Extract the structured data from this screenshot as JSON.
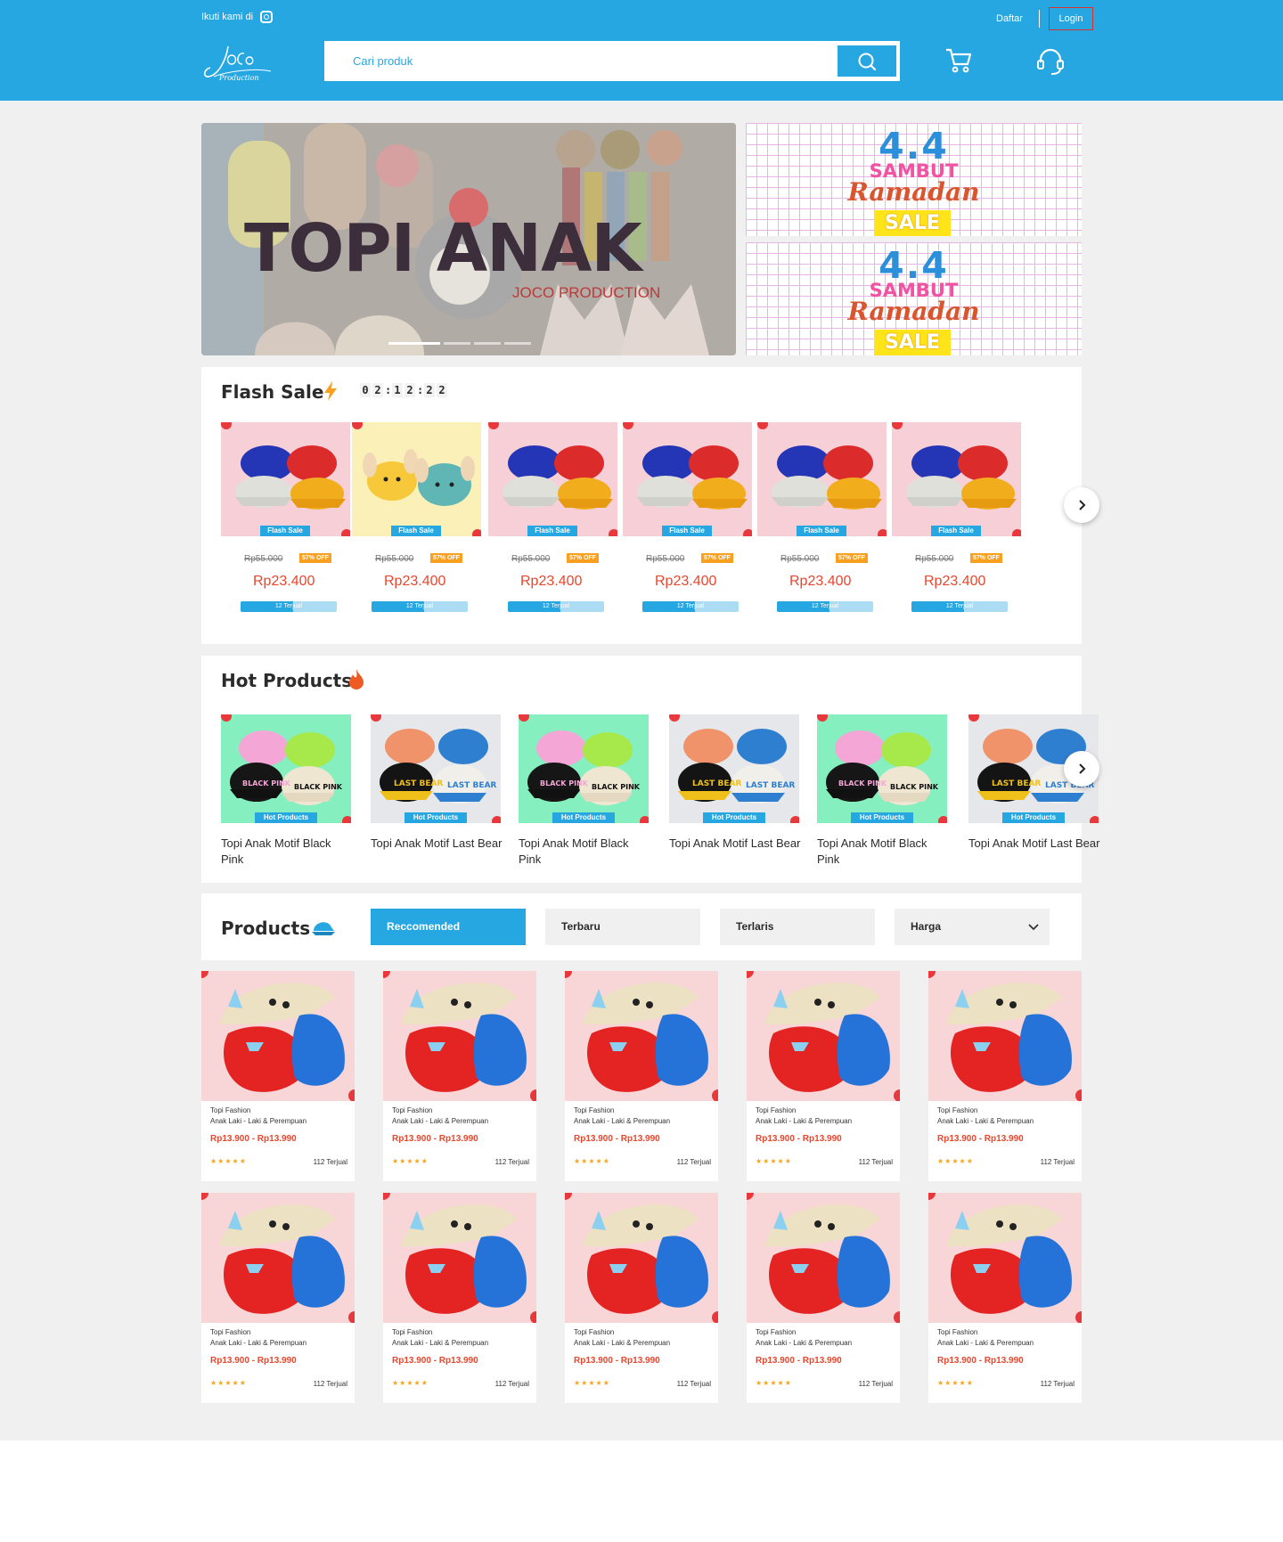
{
  "header": {
    "follow_text": "Ikuti kami di",
    "register_label": "Daftar",
    "login_label": "Login",
    "search_placeholder": "Cari produk",
    "logo_text": "Joco Production"
  },
  "hero": {
    "title": "TOPI ANAK",
    "subtitle": "JOCO PRODUCTION",
    "promo_number": "4.4",
    "promo_line1": "SAMBUT",
    "promo_line2": "Ramadan",
    "promo_line3": "SALE"
  },
  "flash_sale": {
    "title": "Flash Sale",
    "timer": [
      "0",
      "2",
      "1",
      "2",
      "2",
      "2"
    ],
    "items": [
      {
        "badge": "Flash Sale",
        "original_price": "Rp55.000",
        "discount": "57% OFF",
        "price": "Rp23.400",
        "sold": "12 Terjual",
        "sold_fraction": 0.55,
        "variant": "caps"
      },
      {
        "badge": "Flash Sale",
        "original_price": "Rp55.000",
        "discount": "57% OFF",
        "price": "Rp23.400",
        "sold": "12 Terjual",
        "sold_fraction": 0.55,
        "variant": "bunny"
      },
      {
        "badge": "Flash Sale",
        "original_price": "Rp55.000",
        "discount": "57% OFF",
        "price": "Rp23.400",
        "sold": "12 Terjual",
        "sold_fraction": 0.55,
        "variant": "caps"
      },
      {
        "badge": "Flash Sale",
        "original_price": "Rp55.000",
        "discount": "57% OFF",
        "price": "Rp23.400",
        "sold": "12 Terjual",
        "sold_fraction": 0.55,
        "variant": "caps"
      },
      {
        "badge": "Flash Sale",
        "original_price": "Rp55.000",
        "discount": "57% OFF",
        "price": "Rp23.400",
        "sold": "12 Terjual",
        "sold_fraction": 0.55,
        "variant": "caps"
      },
      {
        "badge": "Flash Sale",
        "original_price": "Rp55.000",
        "discount": "57% OFF",
        "price": "Rp23.400",
        "sold": "12 Terjual",
        "sold_fraction": 0.55,
        "variant": "caps"
      }
    ]
  },
  "hot_products": {
    "title": "Hot Products",
    "items": [
      {
        "badge": "Hot Products",
        "name": "Topi Anak Motif Black Pink",
        "variant": "blackpink"
      },
      {
        "badge": "Hot Products",
        "name": "Topi Anak Motif Last Bear",
        "variant": "lastbear"
      },
      {
        "badge": "Hot Products",
        "name": "Topi Anak Motif Black Pink",
        "variant": "blackpink"
      },
      {
        "badge": "Hot Products",
        "name": "Topi Anak Motif Last Bear",
        "variant": "lastbear"
      },
      {
        "badge": "Hot Products",
        "name": "Topi Anak Motif Black Pink",
        "variant": "blackpink"
      },
      {
        "badge": "Hot Products",
        "name": "Topi Anak Motif Last Bear",
        "variant": "lastbear"
      }
    ]
  },
  "products": {
    "title": "Products",
    "tabs": [
      {
        "label": "Reccomended",
        "active": true
      },
      {
        "label": "Terbaru",
        "active": false
      },
      {
        "label": "Terlaris",
        "active": false
      },
      {
        "label": "Harga",
        "active": false,
        "dropdown": true
      }
    ],
    "items": [
      {
        "category": "Topi Fashion",
        "name": "Anak Laki - Laki & Perempuan",
        "price": "Rp13.900 - Rp13.990",
        "rating": 5,
        "sold": "112 Terjual"
      },
      {
        "category": "Topi Fashion",
        "name": "Anak Laki - Laki & Perempuan",
        "price": "Rp13.900 - Rp13.990",
        "rating": 5,
        "sold": "112 Terjual"
      },
      {
        "category": "Topi Fashion",
        "name": "Anak Laki - Laki & Perempuan",
        "price": "Rp13.900 - Rp13.990",
        "rating": 5,
        "sold": "112 Terjual"
      },
      {
        "category": "Topi Fashion",
        "name": "Anak Laki - Laki & Perempuan",
        "price": "Rp13.900 - Rp13.990",
        "rating": 5,
        "sold": "112 Terjual"
      },
      {
        "category": "Topi Fashion",
        "name": "Anak Laki - Laki & Perempuan",
        "price": "Rp13.900 - Rp13.990",
        "rating": 5,
        "sold": "112 Terjual"
      },
      {
        "category": "Topi Fashion",
        "name": "Anak Laki - Laki & Perempuan",
        "price": "Rp13.900 - Rp13.990",
        "rating": 5,
        "sold": "112 Terjual"
      },
      {
        "category": "Topi Fashion",
        "name": "Anak Laki - Laki & Perempuan",
        "price": "Rp13.900 - Rp13.990",
        "rating": 5,
        "sold": "112 Terjual"
      },
      {
        "category": "Topi Fashion",
        "name": "Anak Laki - Laki & Perempuan",
        "price": "Rp13.900 - Rp13.990",
        "rating": 5,
        "sold": "112 Terjual"
      },
      {
        "category": "Topi Fashion",
        "name": "Anak Laki - Laki & Perempuan",
        "price": "Rp13.900 - Rp13.990",
        "rating": 5,
        "sold": "112 Terjual"
      },
      {
        "category": "Topi Fashion",
        "name": "Anak Laki - Laki & Perempuan",
        "price": "Rp13.900 - Rp13.990",
        "rating": 5,
        "sold": "112 Terjual"
      }
    ]
  },
  "colors": {
    "primary": "#26a7e2",
    "price": "#e8462d",
    "discount": "#f9a020",
    "star": "#f5a623"
  }
}
